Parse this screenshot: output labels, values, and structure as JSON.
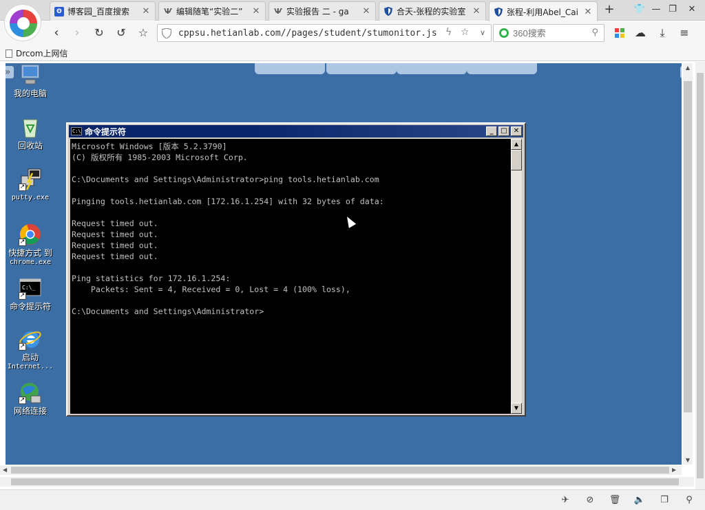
{
  "browser": {
    "tabs": [
      {
        "label": "博客园_百度搜索",
        "icon": "paw-icon"
      },
      {
        "label": "编辑随笔“实验二”",
        "icon": "hetian-icon"
      },
      {
        "label": "实验报告 二 - ga",
        "icon": "hetian-icon"
      },
      {
        "label": "合天-张程的实验室",
        "icon": "shield-icon"
      },
      {
        "label": "张程-利用Abel_Cai",
        "icon": "shield-icon"
      }
    ],
    "address_url": "cppsu.hetianlab.com//pages/student/stumonitor.js",
    "search_placeholder": "360搜索",
    "bookmark_label": "Drcom上网信"
  },
  "desktop": {
    "icons": [
      {
        "label": "我的电脑",
        "icon": "my-computer-icon"
      },
      {
        "label": "回收站",
        "icon": "recycle-bin-icon"
      },
      {
        "label": "putty.exe",
        "icon": "putty-icon"
      },
      {
        "label": "快捷方式 到",
        "label2": "chrome.exe",
        "icon": "chrome-icon"
      },
      {
        "label": "命令提示符",
        "icon": "command-prompt-icon"
      },
      {
        "label": "启动",
        "label2": "Internet...",
        "icon": "internet-explorer-icon"
      },
      {
        "label": "网络连接",
        "icon": "network-connections-icon"
      }
    ]
  },
  "cmd": {
    "title": "命令提示符",
    "lines": [
      "Microsoft Windows [版本 5.2.3790]",
      "(C) 版权所有 1985-2003 Microsoft Corp.",
      "",
      "C:\\Documents and Settings\\Administrator>ping tools.hetianlab.com",
      "",
      "Pinging tools.hetianlab.com [172.16.1.254] with 32 bytes of data:",
      "",
      "Request timed out.",
      "Request timed out.",
      "Request timed out.",
      "Request timed out.",
      "",
      "Ping statistics for 172.16.1.254:",
      "    Packets: Sent = 4, Received = 0, Lost = 4 (100% loss),",
      "",
      "C:\\Documents and Settings\\Administrator>"
    ]
  }
}
